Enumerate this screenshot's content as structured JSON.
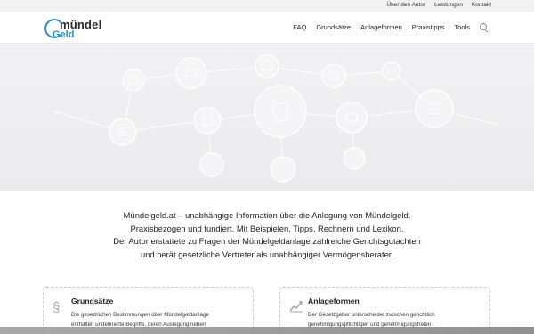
{
  "topbar": {
    "links": [
      "Über den Autor",
      "Leistungen",
      "Kontakt"
    ]
  },
  "logo": {
    "word1": "mündel",
    "word2": "Geld"
  },
  "nav": {
    "items": [
      "FAQ",
      "Grundsätze",
      "Anlageformen",
      "Praxistipps",
      "Tools"
    ]
  },
  "intro": {
    "lines": [
      "Mündelgeld.at – unabhängige Information über die Anlegung von Mündelgeld.",
      "Praxisbezogen und fundiert. Mit Beispielen, Tipps, Rechnern und Lexikon.",
      "Der Autor erstattete zu Fragen der Mündelgeldanlage zahlreiche Gerichtsgutachten",
      "und berät gesetzliche Vertreter als unabhängiger Vermögensberater."
    ]
  },
  "cards": [
    {
      "title": "Grundsätze",
      "icon": "paragraph-icon",
      "lines": [
        "Die gesetzlichen Bestimmungen über Mündelgeldanlage",
        "enthalten undefinierte Begriffe, deren Auslegung neben"
      ]
    },
    {
      "title": "Anlageformen",
      "icon": "chart-icon",
      "lines": [
        "Der Gesetzgeber unterscheidet zwischen gerichtlich",
        "genehmigungspflichtigen und genehmigungsfreien"
      ]
    }
  ],
  "colors": {
    "brand_blue": "#2f8fbf",
    "hero_bg": "#eeeef1",
    "topbar_bg": "#f2f2f2"
  }
}
